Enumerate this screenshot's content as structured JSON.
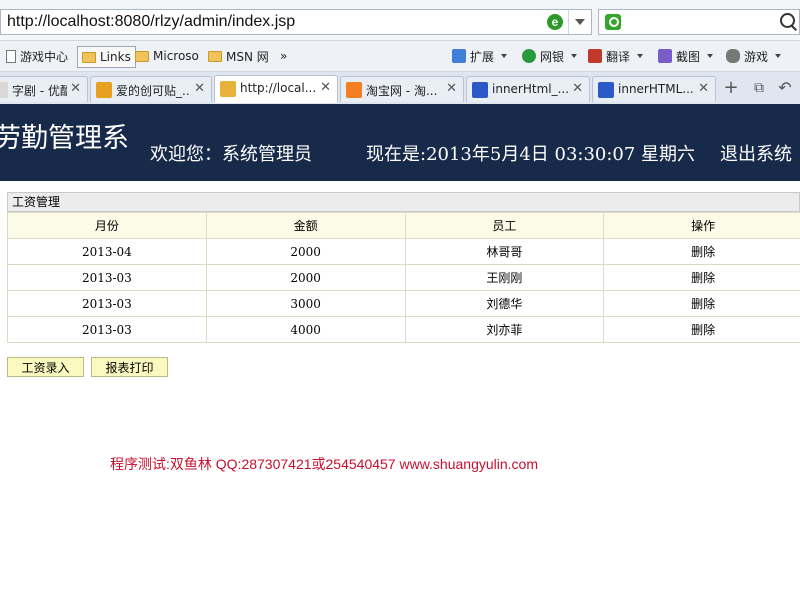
{
  "browser": {
    "url": "http://localhost:8080/rlzy/admin/index.jsp",
    "search_value": "",
    "bookmarks": [
      {
        "label": "游戏中心",
        "type": "page"
      },
      {
        "label": "Links",
        "type": "links"
      },
      {
        "label": "Microso",
        "type": "folder"
      },
      {
        "label": "MSN 网",
        "type": "folder"
      }
    ],
    "more_symbol": "»",
    "tools": [
      {
        "label": "扩展",
        "color": "#3f7fd8"
      },
      {
        "label": "网银",
        "color": "#2a9a3a"
      },
      {
        "label": "翻译",
        "color": "#c0392b"
      },
      {
        "label": "截图",
        "color": "#7a5cc7"
      },
      {
        "label": "游戏",
        "color": "#777777"
      }
    ],
    "tabs": [
      {
        "label": "字剧 - 优酷...",
        "icon_color": "#d8d8d8"
      },
      {
        "label": "爱的创可贴_...",
        "icon_color": "#e6a11e"
      },
      {
        "label": "http://local...",
        "icon_color": "#e7b23a"
      },
      {
        "label": "淘宝网 - 淘...",
        "icon_color": "#f27f22"
      },
      {
        "label": "innerHtml_...",
        "icon_color": "#2d59c8"
      },
      {
        "label": "innerHTML...",
        "icon_color": "#2d59c8"
      }
    ]
  },
  "header": {
    "system_title": "劳勤管理系",
    "welcome": "欢迎您：系统管理员",
    "datetime": "现在是:2013年5月4日  03:30:07 星期六",
    "logout": "退出系统"
  },
  "panel": {
    "title": "工资管理",
    "columns": [
      "月份",
      "金额",
      "员工",
      "操作"
    ],
    "rows": [
      {
        "month": "2013-04",
        "amount": "2000",
        "employee": "林哥哥",
        "action": "删除"
      },
      {
        "month": "2013-03",
        "amount": "2000",
        "employee": "王刚刚",
        "action": "删除"
      },
      {
        "month": "2013-03",
        "amount": "3000",
        "employee": "刘德华",
        "action": "删除"
      },
      {
        "month": "2013-03",
        "amount": "4000",
        "employee": "刘亦菲",
        "action": "删除"
      }
    ],
    "buttons": {
      "add": "工资录入",
      "print": "报表打印"
    }
  },
  "footer_note": "程序测试:双鱼林 QQ:287307421或254540457 www.shuangyulin.com"
}
